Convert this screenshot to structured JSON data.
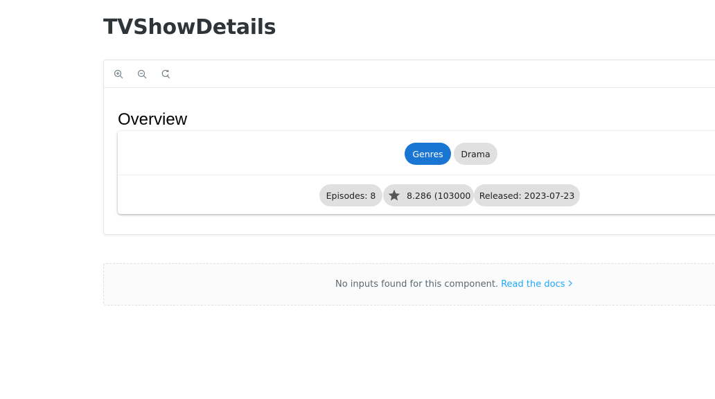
{
  "page": {
    "title": "TVShowDetails"
  },
  "toolbar": {
    "zoom_in_icon": "zoom-in-icon",
    "zoom_out_icon": "zoom-out-icon",
    "reset_zoom_icon": "reset-zoom-icon"
  },
  "component": {
    "heading": "Overview",
    "genres_label": "Genres",
    "genres": [
      "Drama"
    ],
    "episodes": "Episodes: 8",
    "rating": "8.286 (103000",
    "released": "Released: 2023-07-23",
    "colors": {
      "primary": "#1976d2",
      "chip": "#e0e0e0",
      "star": "#555555"
    }
  },
  "inputs": {
    "message": "No inputs found for this component.",
    "link_label": "Read the docs",
    "link_color": "#1ea7fd"
  }
}
